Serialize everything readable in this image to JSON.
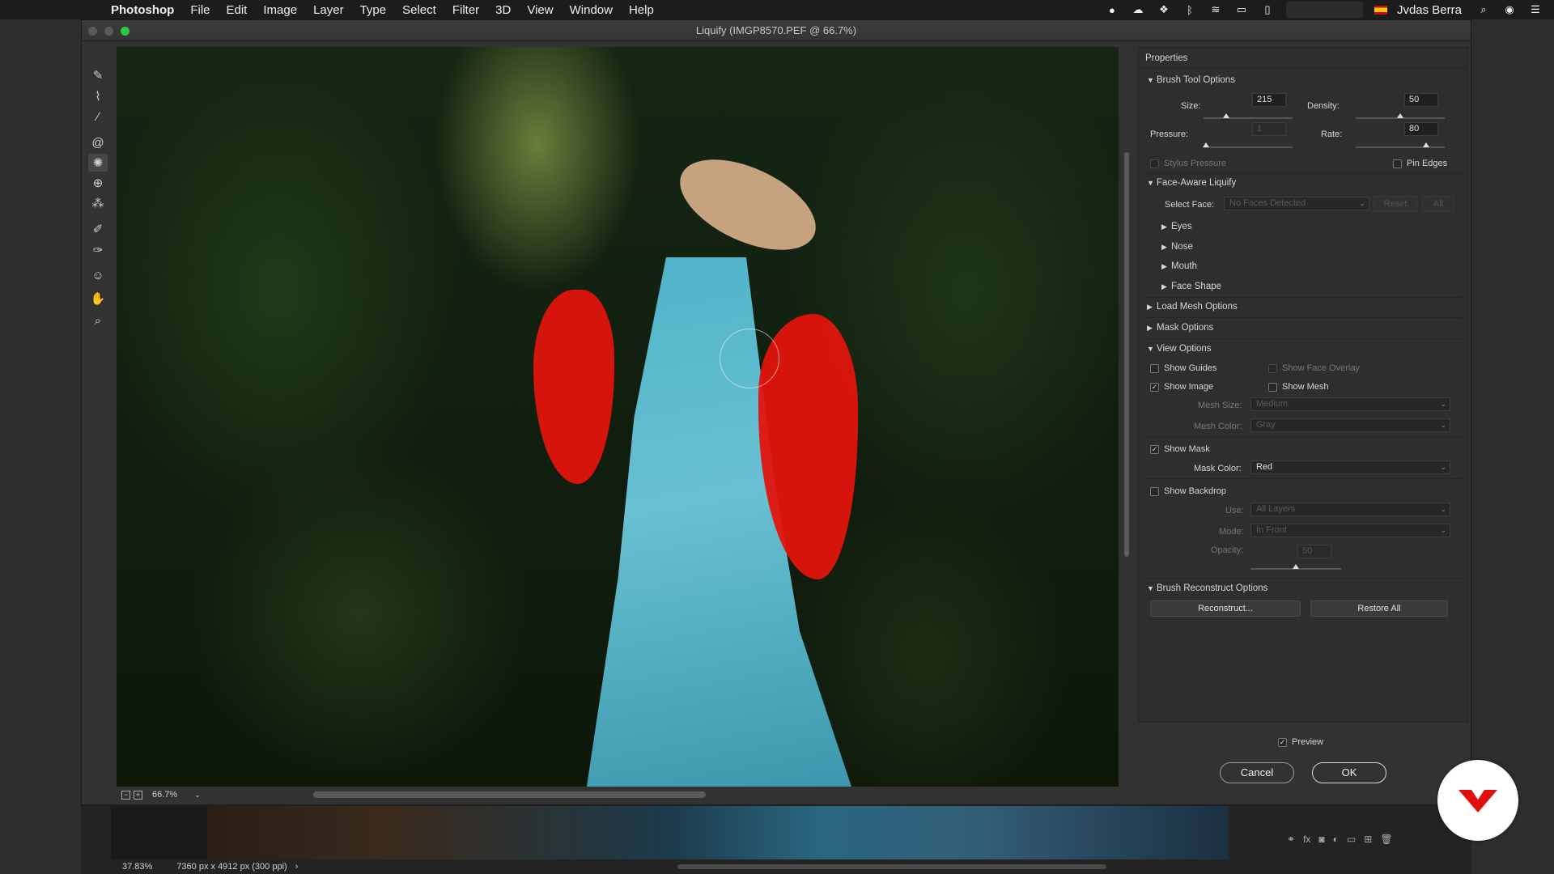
{
  "menubar": {
    "app": "Photoshop",
    "items": [
      "File",
      "Edit",
      "Image",
      "Layer",
      "Type",
      "Select",
      "Filter",
      "3D",
      "View",
      "Window",
      "Help"
    ],
    "user": "Jvdas Berra"
  },
  "dialog": {
    "title": "Liquify (IMGP8570.PEF @ 66.7%)",
    "zoom": "66.7%"
  },
  "properties": {
    "title": "Properties",
    "brush_tool_options": {
      "header": "Brush Tool Options",
      "size_label": "Size:",
      "size_value": "215",
      "density_label": "Density:",
      "density_value": "50",
      "pressure_label": "Pressure:",
      "pressure_value": "1",
      "rate_label": "Rate:",
      "rate_value": "80",
      "stylus_pressure": "Stylus Pressure",
      "pin_edges": "Pin Edges"
    },
    "face_aware": {
      "header": "Face-Aware Liquify",
      "select_face_label": "Select Face:",
      "select_face_value": "No Faces Detected",
      "reset": "Reset",
      "all": "All",
      "eyes": "Eyes",
      "nose": "Nose",
      "mouth": "Mouth",
      "face_shape": "Face Shape"
    },
    "load_mesh": "Load Mesh Options",
    "mask_options": "Mask Options",
    "view_options": {
      "header": "View Options",
      "show_guides": "Show Guides",
      "show_face_overlay": "Show Face Overlay",
      "show_image": "Show Image",
      "show_mesh": "Show Mesh",
      "mesh_size_label": "Mesh Size:",
      "mesh_size_value": "Medium",
      "mesh_color_label": "Mesh Color:",
      "mesh_color_value": "Gray",
      "show_mask": "Show Mask",
      "mask_color_label": "Mask Color:",
      "mask_color_value": "Red",
      "show_backdrop": "Show Backdrop",
      "use_label": "Use:",
      "use_value": "All Layers",
      "mode_label": "Mode:",
      "mode_value": "In Front",
      "opacity_label": "Opacity:",
      "opacity_value": "50"
    },
    "brush_reconstruct": {
      "header": "Brush Reconstruct Options",
      "reconstruct": "Reconstruct...",
      "restore_all": "Restore All"
    }
  },
  "footer": {
    "preview": "Preview",
    "cancel": "Cancel",
    "ok": "OK"
  },
  "statusbar": {
    "zoom": "37.83%",
    "doc_info": "7360 px x 4912 px (300 ppi)"
  },
  "colors": {
    "mask": "#e0140c",
    "dialog_bg": "#323232"
  }
}
